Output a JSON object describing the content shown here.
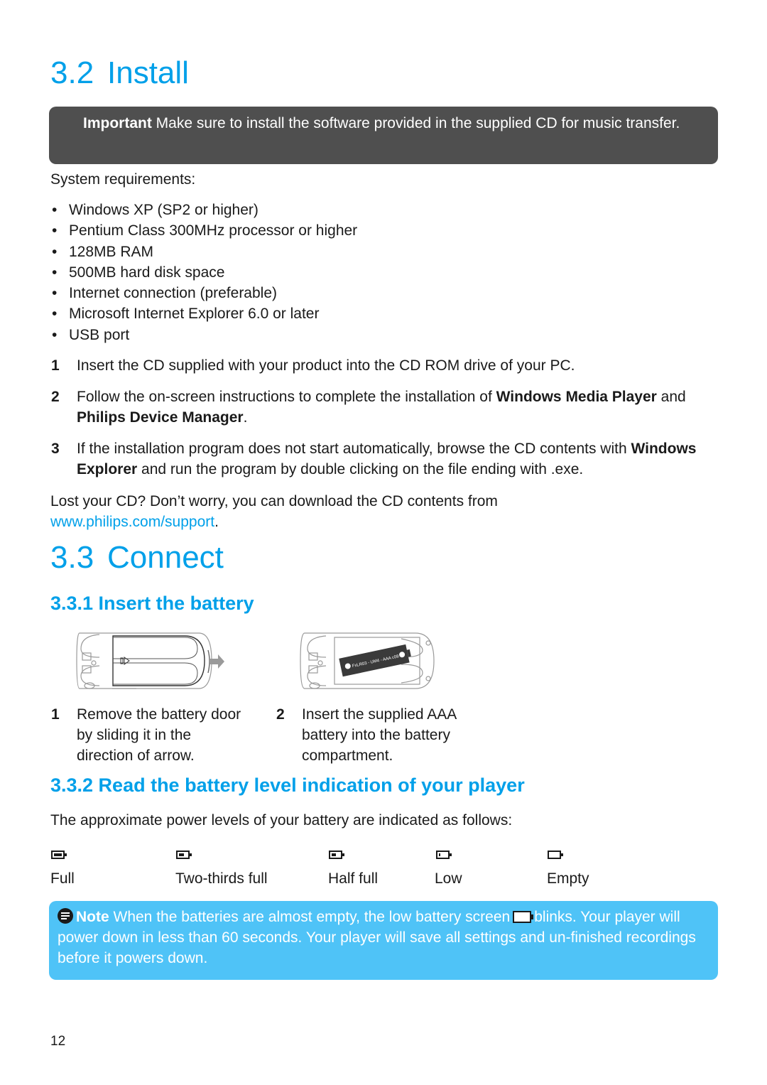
{
  "install": {
    "heading_num": "3.2",
    "heading_text": "Install",
    "important_label": "Important",
    "important_text": " Make sure to install the software provided in the supplied CD for music transfer.",
    "sysreq_label": "System requirements:",
    "requirements": [
      "Windows XP (SP2 or higher)",
      "Pentium Class 300MHz processor or higher",
      "128MB RAM",
      "500MB hard disk space",
      "Internet connection (preferable)",
      "Microsoft Internet Explorer 6.0 or later",
      "USB port"
    ],
    "steps": [
      {
        "num": "1",
        "text": "Insert the CD supplied with your product into the CD ROM drive of your PC."
      },
      {
        "num": "2",
        "pre": "Follow the on-screen instructions to complete the installation of ",
        "b1": "Windows Media Player",
        "mid": " and ",
        "b2": "Philips Device Manager",
        "post": "."
      },
      {
        "num": "3",
        "pre": "If the installation program does not start automatically, browse the CD contents with ",
        "b1": "Windows Explorer",
        "post": " and run the program by double clicking on the file ending with .exe."
      }
    ],
    "lost_cd_text": "Lost your CD? Don’t worry, you can download the CD contents from",
    "support_link": "www.philips.com/support",
    "period": "."
  },
  "connect": {
    "heading_num": "3.3",
    "heading_text": "Connect",
    "insert_battery": {
      "heading": "3.3.1  Insert the battery",
      "battery_label": "FxLR03 - UM4 - AAA c08",
      "steps": [
        {
          "num": "1",
          "lines": [
            "Remove the battery door",
            "by sliding it in the",
            "direction of arrow."
          ]
        },
        {
          "num": "2",
          "lines": [
            "Insert the supplied AAA",
            "battery into the battery",
            "compartment."
          ]
        }
      ]
    },
    "battery_level": {
      "heading": "3.3.2  Read the battery level indication of your player",
      "intro": "The approximate power levels of your battery are indicated as follows:",
      "levels": [
        {
          "label": "Full",
          "level": 1.0,
          "icon": "battery-full-icon"
        },
        {
          "label": "Two-thirds full",
          "level": 0.67,
          "icon": "battery-two-thirds-icon"
        },
        {
          "label": "Half full",
          "level": 0.5,
          "icon": "battery-half-icon"
        },
        {
          "label": "Low",
          "level": 0.15,
          "icon": "battery-low-icon"
        },
        {
          "label": "Empty",
          "level": 0.0,
          "icon": "battery-empty-icon"
        }
      ]
    },
    "note": {
      "label": "Note",
      "text_before": " When the batteries are almost empty, the low battery screen",
      "text_after": "blinks. Your player will power down in less than 60 seconds. Your player will save all settings and un-finished recordings before it powers down."
    }
  },
  "colors": {
    "heading": "#00a0e9",
    "important_bg": "#4f4f4f",
    "note_bg": "#4fc3f7"
  },
  "footer": {
    "page_number": "12"
  }
}
